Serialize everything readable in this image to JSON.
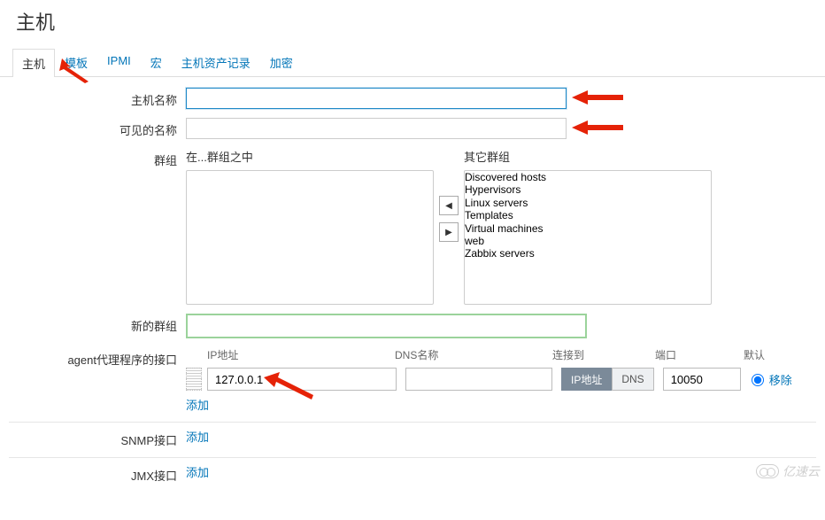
{
  "page_title": "主机",
  "tabs": [
    {
      "label": "主机",
      "active": true
    },
    {
      "label": "模板"
    },
    {
      "label": "IPMI"
    },
    {
      "label": "宏"
    },
    {
      "label": "主机资产记录"
    },
    {
      "label": "加密"
    }
  ],
  "labels": {
    "hostname": "主机名称",
    "visible_name": "可见的名称",
    "groups": "群组",
    "in_groups": "在...群组之中",
    "other_groups": "其它群组",
    "new_group": "新的群组",
    "agent_iface": "agent代理程序的接口",
    "snmp_iface": "SNMP接口",
    "jmx_iface": "JMX接口"
  },
  "form": {
    "hostname": "",
    "visible_name": "",
    "new_group": ""
  },
  "in_groups_list": [],
  "other_groups_list": [
    "Discovered hosts",
    "Hypervisors",
    "Linux servers",
    "Templates",
    "Virtual machines",
    "web",
    "Zabbix servers"
  ],
  "iface_headers": {
    "ip": "IP地址",
    "dns": "DNS名称",
    "conn": "连接到",
    "port": "端口",
    "default": "默认"
  },
  "agent_interface": {
    "ip": "127.0.0.1",
    "dns": "",
    "connect_ip_label": "IP地址",
    "connect_dns_label": "DNS",
    "connect_to": "ip",
    "port": "10050",
    "default": true
  },
  "links": {
    "add": "添加",
    "remove": "移除"
  },
  "watermark": "亿速云"
}
